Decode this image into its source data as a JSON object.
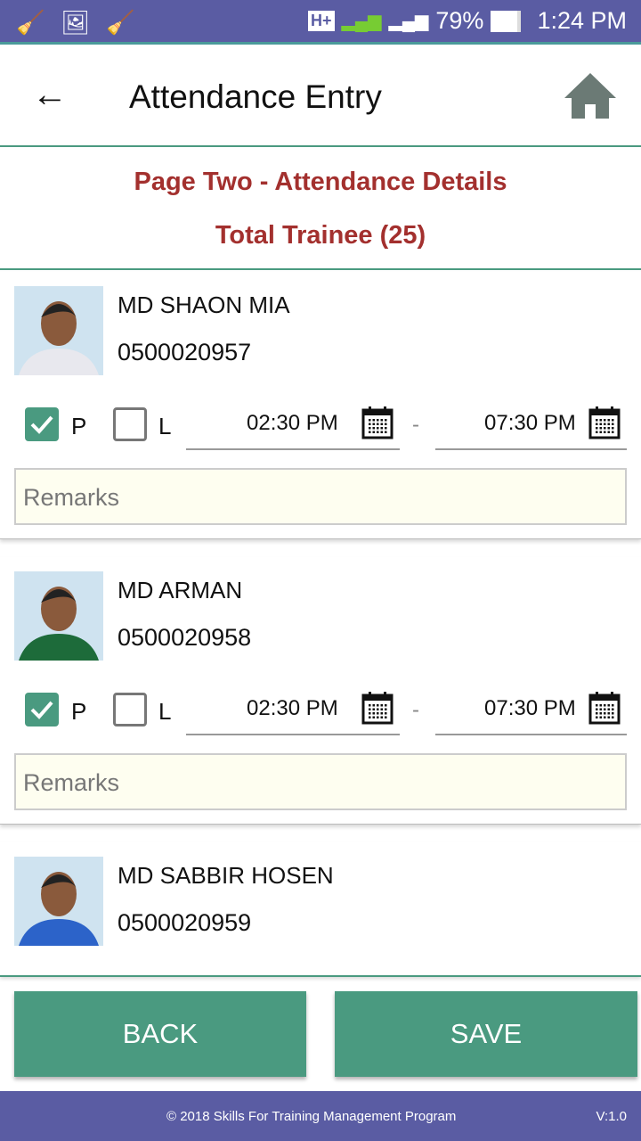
{
  "status_bar": {
    "network": "H+",
    "sim1": "1",
    "sim2": "2",
    "battery": "79%",
    "time": "1:24 PM"
  },
  "header": {
    "title": "Attendance Entry",
    "back_icon": "arrow-left-icon",
    "home_icon": "home-icon"
  },
  "page_title": "Page Two - Attendance Details",
  "total": "Total Trainee (25)",
  "colors": {
    "primary": "#4a9a80",
    "status": "#5a5ca3",
    "title": "#a3302e"
  },
  "trainees": [
    {
      "name": "MD SHAON MIA",
      "id": "0500020957",
      "present": true,
      "late": false,
      "p": "P",
      "l": "L",
      "start": "02:30 PM",
      "end": "07:30 PM",
      "dash": "-",
      "remarks_placeholder": "Remarks"
    },
    {
      "name": "MD ARMAN",
      "id": "0500020958",
      "present": true,
      "late": false,
      "p": "P",
      "l": "L",
      "start": "02:30 PM",
      "end": "07:30 PM",
      "dash": "-",
      "remarks_placeholder": "Remarks"
    },
    {
      "name": "MD SABBIR HOSEN",
      "id": "0500020959"
    }
  ],
  "buttons": {
    "back": "BACK",
    "save": "SAVE"
  },
  "footer": {
    "copyright": "© 2018 Skills For Training Management Program",
    "version": "V:1.0"
  }
}
